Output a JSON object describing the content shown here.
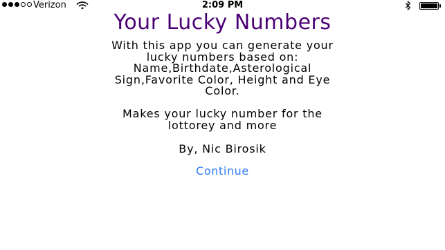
{
  "status_bar": {
    "signal_strength": 3,
    "signal_max": 5,
    "carrier": "Verizon",
    "wifi_icon": "wifi-icon",
    "time": "2:09 PM",
    "bluetooth_icon": "bluetooth-icon",
    "battery_level": 1.0
  },
  "app": {
    "title": "Your Lucky Numbers",
    "title_color": "#4b0075",
    "description_lines": [
      "With this app you can generate your",
      "lucky numbers based on:",
      "Name,Birthdate,Asterological",
      "Sign,Favorite Color, Height and Eye",
      "Color."
    ],
    "lottery_lines": [
      "Makes your lucky number for the",
      "lottorey and more"
    ],
    "author": "By, Nic Birosik",
    "continue_label": "Continue",
    "link_color": "#2f7cf6"
  }
}
